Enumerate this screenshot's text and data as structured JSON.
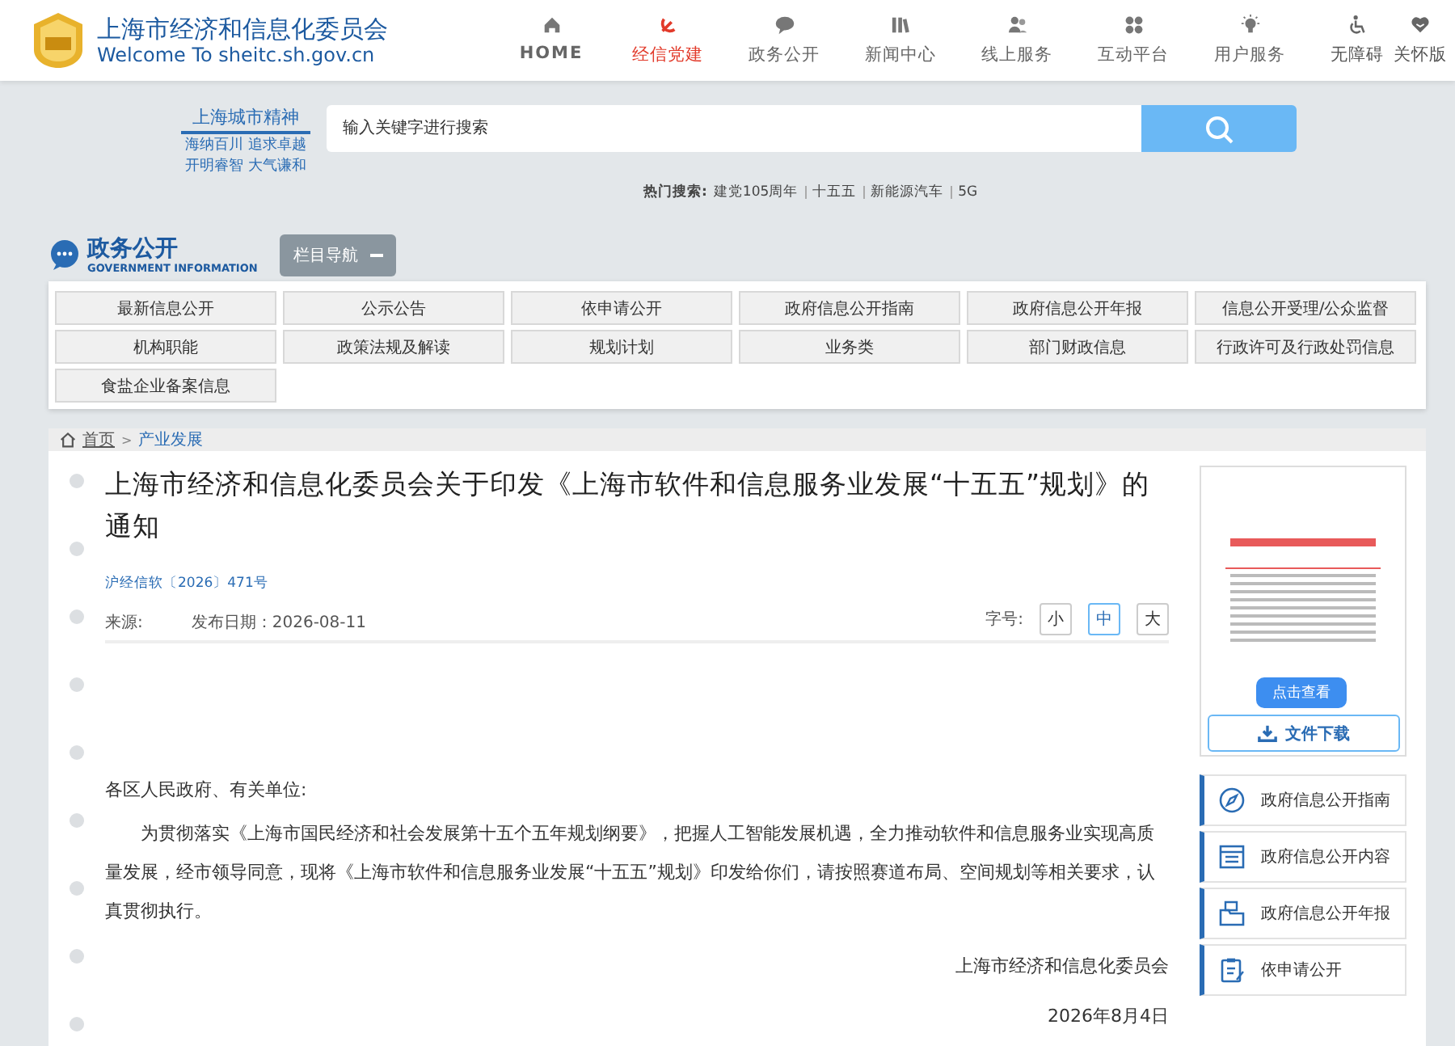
{
  "header": {
    "site_title": "上海市经济和信息化委员会",
    "site_subtitle": "Welcome To sheitc.sh.gov.cn",
    "nav": [
      {
        "label": "HOME",
        "selected": false
      },
      {
        "label": "经信党建",
        "selected": true
      },
      {
        "label": "政务公开",
        "selected": false
      },
      {
        "label": "新闻中心",
        "selected": false
      },
      {
        "label": "线上服务",
        "selected": false
      },
      {
        "label": "互动平台",
        "selected": false
      },
      {
        "label": "用户服务",
        "selected": false
      }
    ],
    "tools": [
      "无障碍",
      "关怀版"
    ]
  },
  "search": {
    "spirit_title": "上海城市精神",
    "spirit_lines": [
      "海纳百川 追求卓越",
      "开明睿智 大气谦和"
    ],
    "placeholder": "输入关键字进行搜索",
    "hot_label": "热门搜索:",
    "hot_terms": [
      "建党105周年",
      "十五五",
      "新能源汽车",
      "5G"
    ]
  },
  "gov_info": {
    "title": "政务公开",
    "subtitle": "GOVERNMENT INFORMATION",
    "nav_toggle": "栏目导航",
    "categories": [
      "最新信息公开",
      "公示公告",
      "依申请公开",
      "政府信息公开指南",
      "政府信息公开年报",
      "信息公开受理/公众监督",
      "机构职能",
      "政策法规及解读",
      "规划计划",
      "业务类",
      "部门财政信息",
      "行政许可及行政处罚信息",
      "食盐企业备案信息"
    ]
  },
  "breadcrumb": [
    "首页",
    "产业发展"
  ],
  "breadcrumb_separator": ">",
  "article": {
    "title": "上海市经济和信息化委员会关于印发《上海市软件和信息服务业发展“十五五”规划》的通知",
    "doc_number": "沪经信软〔2026〕471号",
    "source_label": "来源:",
    "date": "发布日期：2026-08-11",
    "font_label": "字号:",
    "font_sizes": [
      {
        "label": "小",
        "selected": false
      },
      {
        "label": "中",
        "selected": true
      },
      {
        "label": "大",
        "selected": false
      }
    ],
    "salutation": "各区人民政府、有关单位:",
    "paragraph": "为贯彻落实《上海市国民经济和社会发展第十五个五年规划纲要》，把握人工智能发展机遇，全力推动软件和信息服务业实现高质量发展，经市领导同意，现将《上海市软件和信息服务业发展“十五五”规划》印发给你们，请按照赛道布局、空间规划等相关要求，认真贯彻执行。",
    "signature": "上海市经济和信息化委员会",
    "sign_date": "2026年8月4日"
  },
  "sidebar": {
    "view_button": "点击查看",
    "download_button": "文件下载",
    "links": [
      "政府信息公开指南",
      "政府信息公开内容",
      "政府信息公开年报",
      "依申请公开"
    ]
  }
}
